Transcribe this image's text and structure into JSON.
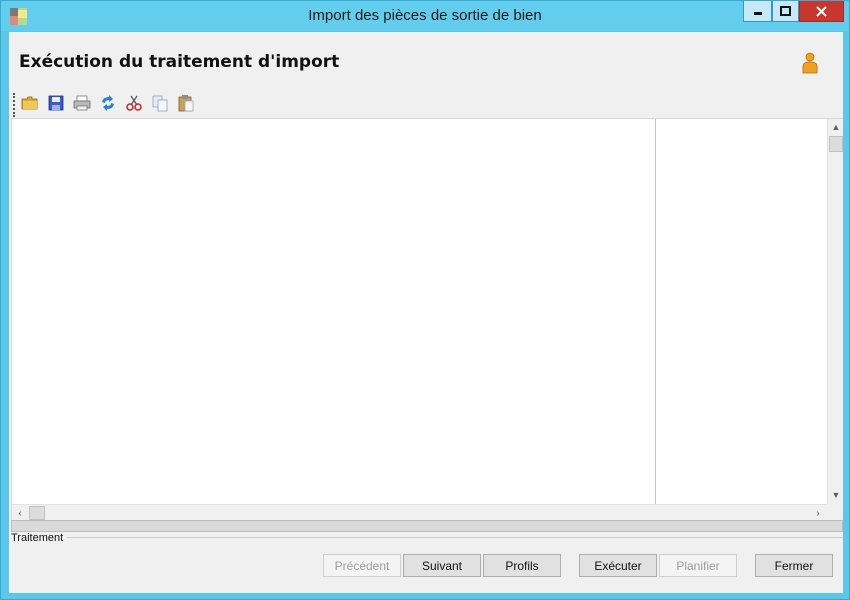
{
  "window": {
    "title": "Import des pièces de sortie de bien"
  },
  "heading": "Exécution du traitement d'import",
  "toolbar": {
    "items": [
      "folder-open-icon",
      "save-icon",
      "print-icon",
      "refresh-icon",
      "cut-icon",
      "copy-icon",
      "paste-icon"
    ]
  },
  "group": {
    "label": "Traitement"
  },
  "buttons": {
    "previous": "Précédent",
    "next": "Suivant",
    "profiles": "Profils",
    "execute": "Exécuter",
    "schedule": "Planifier",
    "close": "Fermer"
  },
  "colors": {
    "titlebar": "#63cdee",
    "close_button": "#c7372f"
  }
}
